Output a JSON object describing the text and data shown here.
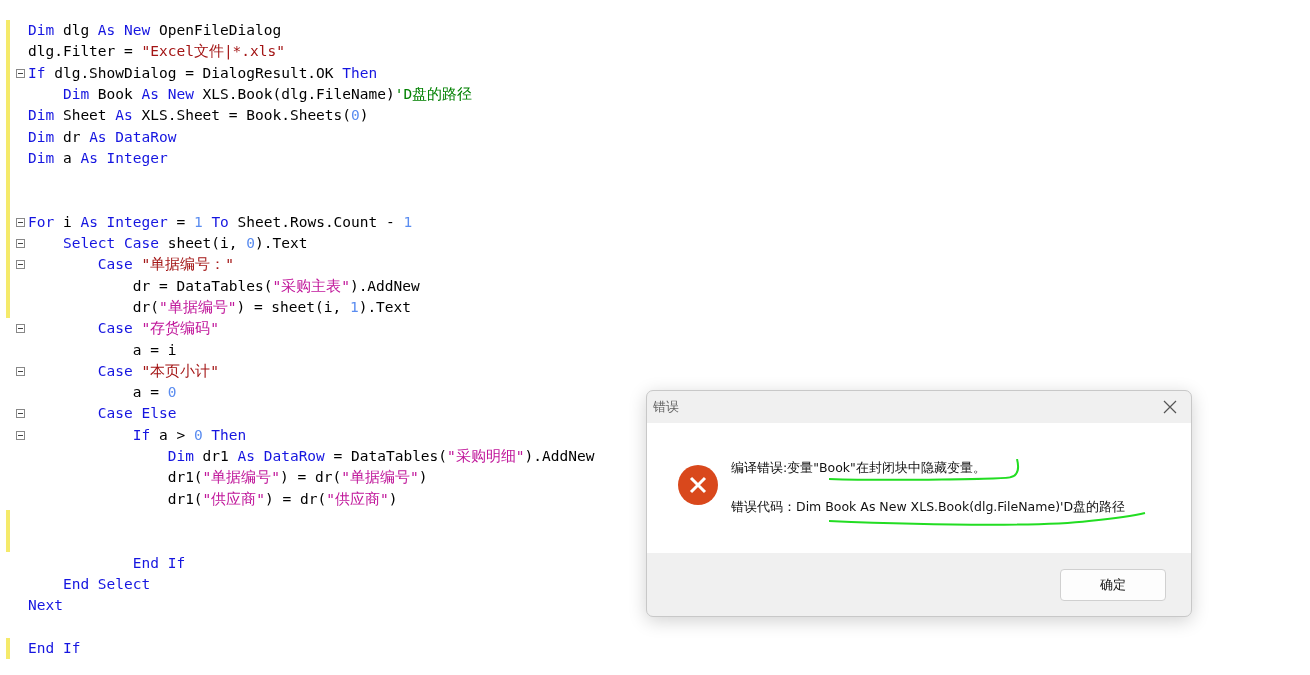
{
  "editor": {
    "lines": [
      {
        "changed": true,
        "fold": false,
        "tokens": [
          {
            "kind": "kw",
            "text": "Dim"
          },
          {
            "kind": "plain",
            "text": " dlg "
          },
          {
            "kind": "kw",
            "text": "As New"
          },
          {
            "kind": "plain",
            "text": " OpenFileDialog"
          }
        ]
      },
      {
        "changed": true,
        "fold": false,
        "tokens": [
          {
            "kind": "plain",
            "text": "dlg.Filter = "
          },
          {
            "kind": "str",
            "text": "\"Excel文件|*.xls\""
          }
        ]
      },
      {
        "changed": true,
        "fold": true,
        "tokens": [
          {
            "kind": "kw",
            "text": "If"
          },
          {
            "kind": "plain",
            "text": " dlg.ShowDialog = DialogResult.OK "
          },
          {
            "kind": "kw",
            "text": "Then"
          }
        ]
      },
      {
        "changed": true,
        "fold": false,
        "tokens": [
          {
            "kind": "kw",
            "text": "    Dim"
          },
          {
            "kind": "plain",
            "text": " Book "
          },
          {
            "kind": "kw",
            "text": "As New"
          },
          {
            "kind": "plain",
            "text": " XLS.Book(dlg.FileName)"
          },
          {
            "kind": "comment",
            "text": "'D盘的路径"
          }
        ]
      },
      {
        "changed": true,
        "fold": false,
        "tokens": [
          {
            "kind": "kw",
            "text": "Dim"
          },
          {
            "kind": "plain",
            "text": " Sheet "
          },
          {
            "kind": "kw",
            "text": "As"
          },
          {
            "kind": "plain",
            "text": " XLS.Sheet = Book.Sheets("
          },
          {
            "kind": "num",
            "text": "0"
          },
          {
            "kind": "plain",
            "text": ")"
          }
        ]
      },
      {
        "changed": true,
        "fold": false,
        "tokens": [
          {
            "kind": "kw",
            "text": "Dim"
          },
          {
            "kind": "plain",
            "text": " dr "
          },
          {
            "kind": "kw",
            "text": "As DataRow"
          }
        ]
      },
      {
        "changed": true,
        "fold": false,
        "tokens": [
          {
            "kind": "kw",
            "text": "Dim"
          },
          {
            "kind": "plain",
            "text": " a "
          },
          {
            "kind": "kw",
            "text": "As Integer"
          }
        ]
      },
      {
        "changed": true,
        "fold": false
      },
      {
        "changed": true,
        "fold": false
      },
      {
        "changed": true,
        "fold": true,
        "tokens": [
          {
            "kind": "kw",
            "text": "For"
          },
          {
            "kind": "plain",
            "text": " i "
          },
          {
            "kind": "kw",
            "text": "As Integer"
          },
          {
            "kind": "plain",
            "text": " = "
          },
          {
            "kind": "num",
            "text": "1"
          },
          {
            "kind": "kw",
            "text": " To"
          },
          {
            "kind": "plain",
            "text": " Sheet.Rows.Count - "
          },
          {
            "kind": "num",
            "text": "1"
          }
        ]
      },
      {
        "changed": true,
        "fold": true,
        "tokens": [
          {
            "kind": "kw",
            "text": "    Select Case"
          },
          {
            "kind": "plain",
            "text": " sheet(i, "
          },
          {
            "kind": "num",
            "text": "0"
          },
          {
            "kind": "plain",
            "text": ").Text"
          }
        ]
      },
      {
        "changed": true,
        "fold": true,
        "tokens": [
          {
            "kind": "kw",
            "text": "        Case"
          },
          {
            "kind": "str",
            "text": " \"单据编号：\""
          }
        ]
      },
      {
        "changed": true,
        "fold": false,
        "tokens": [
          {
            "kind": "plain",
            "text": "            dr = DataTables("
          },
          {
            "kind": "str2",
            "text": "\"采购主表\""
          },
          {
            "kind": "plain",
            "text": ").AddNew"
          }
        ]
      },
      {
        "changed": true,
        "fold": false,
        "tokens": [
          {
            "kind": "plain",
            "text": "            dr("
          },
          {
            "kind": "str2",
            "text": "\"单据编号\""
          },
          {
            "kind": "plain",
            "text": ") = sheet(i, "
          },
          {
            "kind": "num",
            "text": "1"
          },
          {
            "kind": "plain",
            "text": ").Text"
          }
        ]
      },
      {
        "changed": false,
        "fold": true,
        "tokens": [
          {
            "kind": "kw",
            "text": "        Case"
          },
          {
            "kind": "str2",
            "text": " \"存货编码\""
          }
        ]
      },
      {
        "changed": false,
        "fold": false,
        "tokens": [
          {
            "kind": "plain",
            "text": "            a = i"
          }
        ]
      },
      {
        "changed": false,
        "fold": true,
        "tokens": [
          {
            "kind": "kw",
            "text": "        Case"
          },
          {
            "kind": "str",
            "text": " \"本页小计\""
          }
        ]
      },
      {
        "changed": false,
        "fold": false,
        "tokens": [
          {
            "kind": "plain",
            "text": "            a = "
          },
          {
            "kind": "num",
            "text": "0"
          }
        ]
      },
      {
        "changed": false,
        "fold": true,
        "tokens": [
          {
            "kind": "kw",
            "text": "        Case Else"
          }
        ]
      },
      {
        "changed": false,
        "fold": true,
        "tokens": [
          {
            "kind": "kw",
            "text": "            If"
          },
          {
            "kind": "plain",
            "text": " a > "
          },
          {
            "kind": "num",
            "text": "0"
          },
          {
            "kind": "kw",
            "text": " Then"
          }
        ]
      },
      {
        "changed": false,
        "fold": false,
        "tokens": [
          {
            "kind": "kw",
            "text": "                Dim"
          },
          {
            "kind": "plain",
            "text": " dr1 "
          },
          {
            "kind": "kw",
            "text": "As DataRow"
          },
          {
            "kind": "plain",
            "text": " = DataTables("
          },
          {
            "kind": "str2",
            "text": "\"采购明细\""
          },
          {
            "kind": "plain",
            "text": ").AddNew"
          }
        ]
      },
      {
        "changed": false,
        "fold": false,
        "tokens": [
          {
            "kind": "plain",
            "text": "                dr1("
          },
          {
            "kind": "str2",
            "text": "\"单据编号\""
          },
          {
            "kind": "plain",
            "text": ") = dr("
          },
          {
            "kind": "str2",
            "text": "\"单据编号\""
          },
          {
            "kind": "plain",
            "text": ")"
          }
        ]
      },
      {
        "changed": false,
        "fold": false,
        "tokens": [
          {
            "kind": "plain",
            "text": "                dr1("
          },
          {
            "kind": "str2",
            "text": "\"供应商\""
          },
          {
            "kind": "plain",
            "text": ") = dr("
          },
          {
            "kind": "str2",
            "text": "\"供应商\""
          },
          {
            "kind": "plain",
            "text": ")"
          }
        ]
      },
      {
        "changed": true,
        "fold": false
      },
      {
        "changed": true,
        "fold": false
      },
      {
        "changed": false,
        "fold": false,
        "tokens": [
          {
            "kind": "kw",
            "text": "            End If"
          }
        ]
      },
      {
        "changed": false,
        "fold": false,
        "tokens": [
          {
            "kind": "kw",
            "text": "    End Select"
          }
        ]
      },
      {
        "changed": false,
        "fold": false,
        "tokens": [
          {
            "kind": "kw",
            "text": "Next"
          }
        ]
      },
      {
        "changed": false,
        "fold": false
      },
      {
        "changed": true,
        "fold": false,
        "tokens": [
          {
            "kind": "kw",
            "text": "End If"
          }
        ]
      }
    ]
  },
  "dialog": {
    "title": "错误",
    "message": "编译错误:变量\"Book\"在封闭块中隐藏变量。",
    "error_code": "错误代码：Dim Book As New XLS.Book(dlg.FileName)'D盘的路径",
    "buttons": [
      "确定"
    ]
  }
}
